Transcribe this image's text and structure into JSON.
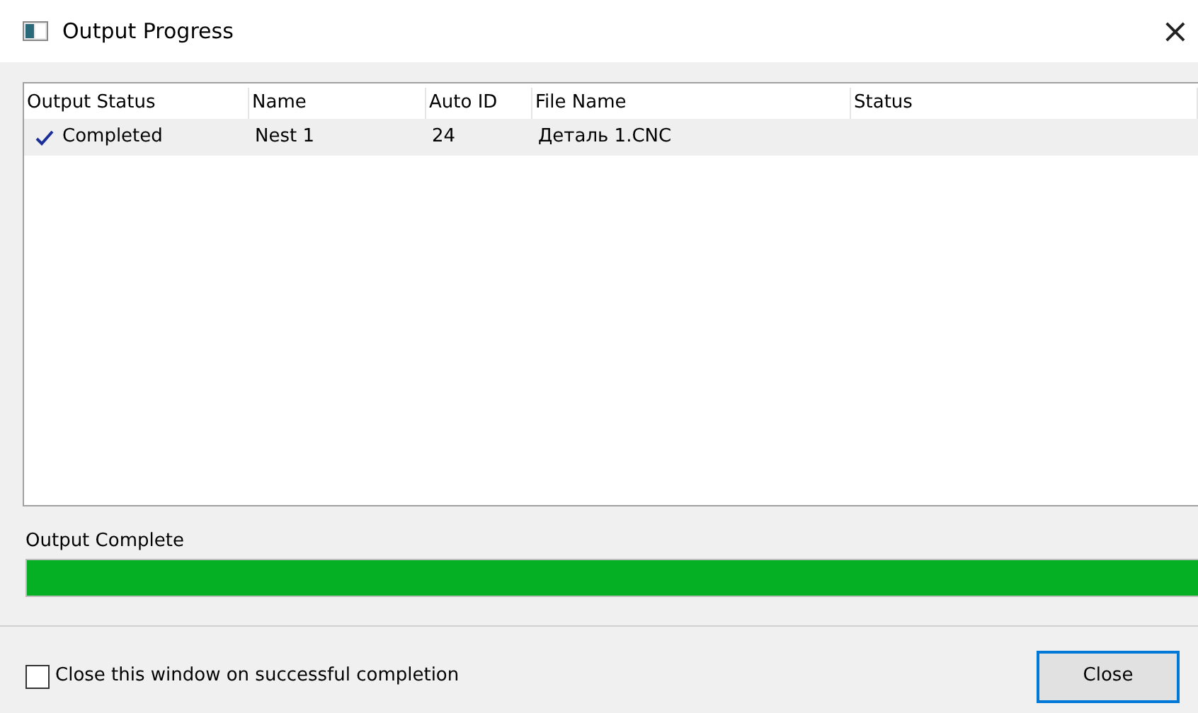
{
  "window": {
    "title": "Output Progress",
    "close_glyph": "×"
  },
  "table": {
    "columns": [
      "Output Status",
      "Name",
      "Auto ID",
      "File Name",
      "Status"
    ],
    "rows": [
      {
        "cells": [
          "Completed",
          "Nest 1",
          "24",
          "Деталь 1.CNC",
          ""
        ],
        "completed": true,
        "selected": true
      }
    ]
  },
  "progress": {
    "label": "Output Complete",
    "level": 1
  },
  "footer": {
    "checkbox": {
      "label": "Close this window on successful completion",
      "checked": false
    },
    "button": "Close"
  }
}
